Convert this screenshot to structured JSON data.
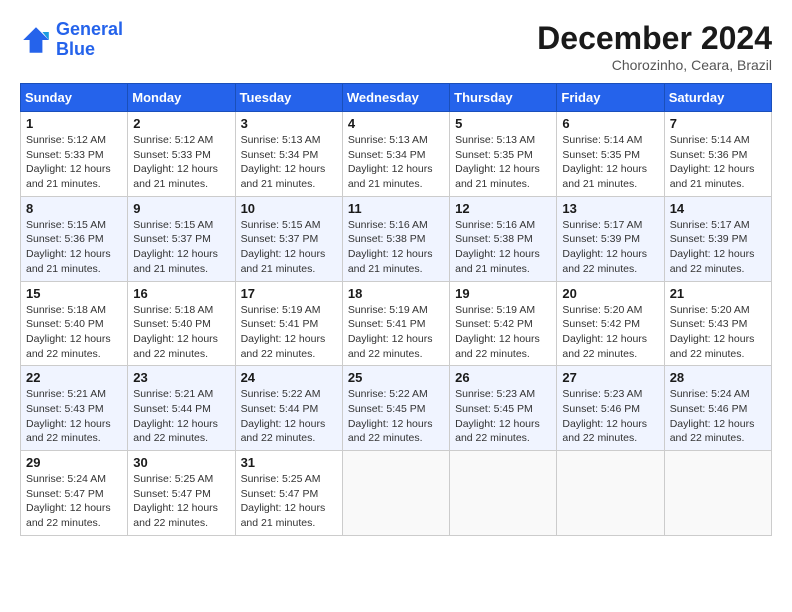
{
  "header": {
    "logo_line1": "General",
    "logo_line2": "Blue",
    "month": "December 2024",
    "location": "Chorozinho, Ceara, Brazil"
  },
  "weekdays": [
    "Sunday",
    "Monday",
    "Tuesday",
    "Wednesday",
    "Thursday",
    "Friday",
    "Saturday"
  ],
  "weeks": [
    [
      {
        "day": "1",
        "sunrise": "5:12 AM",
        "sunset": "5:33 PM",
        "daylight": "12 hours and 21 minutes."
      },
      {
        "day": "2",
        "sunrise": "5:12 AM",
        "sunset": "5:33 PM",
        "daylight": "12 hours and 21 minutes."
      },
      {
        "day": "3",
        "sunrise": "5:13 AM",
        "sunset": "5:34 PM",
        "daylight": "12 hours and 21 minutes."
      },
      {
        "day": "4",
        "sunrise": "5:13 AM",
        "sunset": "5:34 PM",
        "daylight": "12 hours and 21 minutes."
      },
      {
        "day": "5",
        "sunrise": "5:13 AM",
        "sunset": "5:35 PM",
        "daylight": "12 hours and 21 minutes."
      },
      {
        "day": "6",
        "sunrise": "5:14 AM",
        "sunset": "5:35 PM",
        "daylight": "12 hours and 21 minutes."
      },
      {
        "day": "7",
        "sunrise": "5:14 AM",
        "sunset": "5:36 PM",
        "daylight": "12 hours and 21 minutes."
      }
    ],
    [
      {
        "day": "8",
        "sunrise": "5:15 AM",
        "sunset": "5:36 PM",
        "daylight": "12 hours and 21 minutes."
      },
      {
        "day": "9",
        "sunrise": "5:15 AM",
        "sunset": "5:37 PM",
        "daylight": "12 hours and 21 minutes."
      },
      {
        "day": "10",
        "sunrise": "5:15 AM",
        "sunset": "5:37 PM",
        "daylight": "12 hours and 21 minutes."
      },
      {
        "day": "11",
        "sunrise": "5:16 AM",
        "sunset": "5:38 PM",
        "daylight": "12 hours and 21 minutes."
      },
      {
        "day": "12",
        "sunrise": "5:16 AM",
        "sunset": "5:38 PM",
        "daylight": "12 hours and 21 minutes."
      },
      {
        "day": "13",
        "sunrise": "5:17 AM",
        "sunset": "5:39 PM",
        "daylight": "12 hours and 22 minutes."
      },
      {
        "day": "14",
        "sunrise": "5:17 AM",
        "sunset": "5:39 PM",
        "daylight": "12 hours and 22 minutes."
      }
    ],
    [
      {
        "day": "15",
        "sunrise": "5:18 AM",
        "sunset": "5:40 PM",
        "daylight": "12 hours and 22 minutes."
      },
      {
        "day": "16",
        "sunrise": "5:18 AM",
        "sunset": "5:40 PM",
        "daylight": "12 hours and 22 minutes."
      },
      {
        "day": "17",
        "sunrise": "5:19 AM",
        "sunset": "5:41 PM",
        "daylight": "12 hours and 22 minutes."
      },
      {
        "day": "18",
        "sunrise": "5:19 AM",
        "sunset": "5:41 PM",
        "daylight": "12 hours and 22 minutes."
      },
      {
        "day": "19",
        "sunrise": "5:19 AM",
        "sunset": "5:42 PM",
        "daylight": "12 hours and 22 minutes."
      },
      {
        "day": "20",
        "sunrise": "5:20 AM",
        "sunset": "5:42 PM",
        "daylight": "12 hours and 22 minutes."
      },
      {
        "day": "21",
        "sunrise": "5:20 AM",
        "sunset": "5:43 PM",
        "daylight": "12 hours and 22 minutes."
      }
    ],
    [
      {
        "day": "22",
        "sunrise": "5:21 AM",
        "sunset": "5:43 PM",
        "daylight": "12 hours and 22 minutes."
      },
      {
        "day": "23",
        "sunrise": "5:21 AM",
        "sunset": "5:44 PM",
        "daylight": "12 hours and 22 minutes."
      },
      {
        "day": "24",
        "sunrise": "5:22 AM",
        "sunset": "5:44 PM",
        "daylight": "12 hours and 22 minutes."
      },
      {
        "day": "25",
        "sunrise": "5:22 AM",
        "sunset": "5:45 PM",
        "daylight": "12 hours and 22 minutes."
      },
      {
        "day": "26",
        "sunrise": "5:23 AM",
        "sunset": "5:45 PM",
        "daylight": "12 hours and 22 minutes."
      },
      {
        "day": "27",
        "sunrise": "5:23 AM",
        "sunset": "5:46 PM",
        "daylight": "12 hours and 22 minutes."
      },
      {
        "day": "28",
        "sunrise": "5:24 AM",
        "sunset": "5:46 PM",
        "daylight": "12 hours and 22 minutes."
      }
    ],
    [
      {
        "day": "29",
        "sunrise": "5:24 AM",
        "sunset": "5:47 PM",
        "daylight": "12 hours and 22 minutes."
      },
      {
        "day": "30",
        "sunrise": "5:25 AM",
        "sunset": "5:47 PM",
        "daylight": "12 hours and 22 minutes."
      },
      {
        "day": "31",
        "sunrise": "5:25 AM",
        "sunset": "5:47 PM",
        "daylight": "12 hours and 21 minutes."
      },
      null,
      null,
      null,
      null
    ]
  ]
}
